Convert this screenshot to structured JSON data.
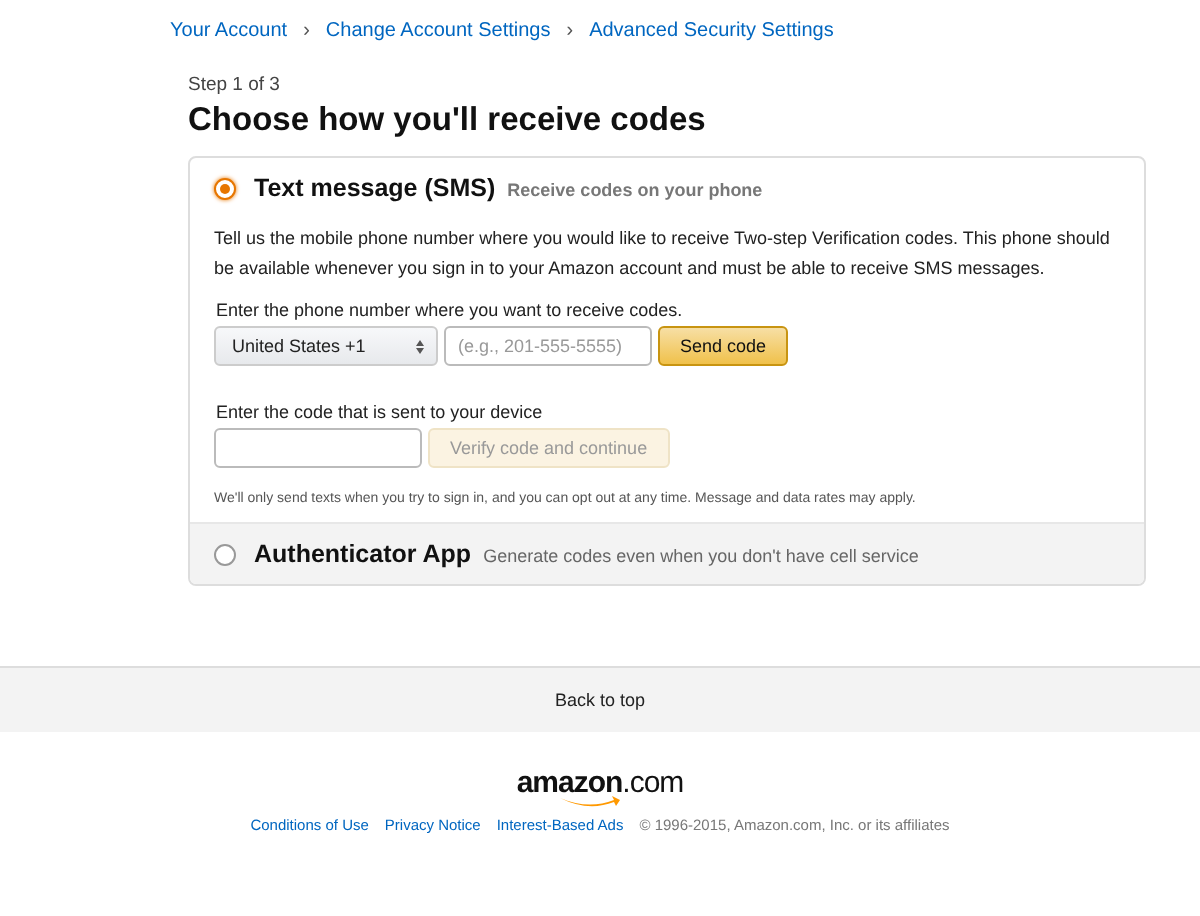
{
  "breadcrumb": [
    "Your Account",
    "Change Account Settings",
    "Advanced Security Settings"
  ],
  "breadcrumb_separator": "›",
  "step": "Step 1 of 3",
  "heading": "Choose how you'll receive codes",
  "options": [
    {
      "title": "Text message (SMS)",
      "subtitle": "Receive codes on your phone",
      "selected": true,
      "details": {
        "intro": "Tell us the mobile phone number where you would like to receive Two-step Verification codes. This phone should be available whenever you sign in to your Amazon account and must be able to receive SMS messages.",
        "phone_label": "Enter the phone number where you want to receive codes.",
        "country": "United States +1",
        "phone_placeholder": "(e.g., 201-555-5555)",
        "send_button": "Send code",
        "code_label": "Enter the code that is sent to your device",
        "verify_button": "Verify code and continue",
        "verify_disabled": true,
        "note": "We'll only send texts when you try to sign in, and you can opt out at any time. Message and data rates may apply."
      }
    },
    {
      "title": "Authenticator App",
      "subtitle": "Generate codes even when you don't have cell service",
      "selected": false
    }
  ],
  "back_to_top": "Back to top",
  "logo": "**amazon**.com",
  "footer_links": [
    "Conditions of Use",
    "Privacy Notice",
    "Interest-Based Ads"
  ],
  "copyright": "© 1996-2015, Amazon.com, Inc. or its affiliates"
}
